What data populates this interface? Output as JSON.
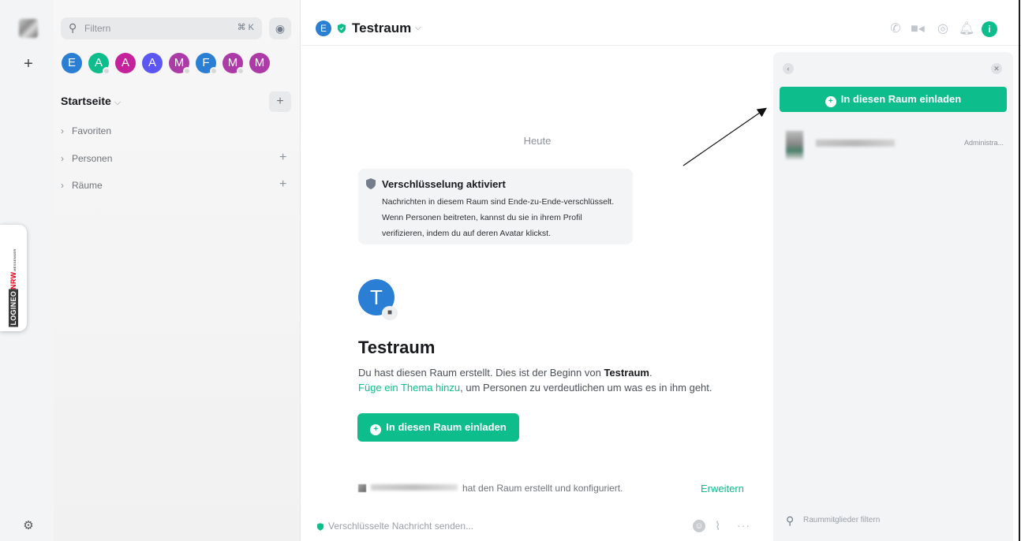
{
  "search": {
    "placeholder": "Filtern",
    "shortcut": "⌘ K"
  },
  "recents": [
    {
      "letter": "E",
      "color": "#2a7fd4"
    },
    {
      "letter": "A",
      "color": "#0dbd8b"
    },
    {
      "letter": "A",
      "color": "#c4219d"
    },
    {
      "letter": "A",
      "color": "#5c56f5"
    },
    {
      "letter": "M",
      "color": "#ac3ba8"
    },
    {
      "letter": "F",
      "color": "#2a7fd4"
    },
    {
      "letter": "M",
      "color": "#ac3ba8"
    },
    {
      "letter": "M",
      "color": "#ac3ba8"
    }
  ],
  "home": {
    "title": "Startseite"
  },
  "sections": {
    "favorites": "Favoriten",
    "people": "Personen",
    "rooms": "Räume"
  },
  "branding": {
    "log": "LOGINEO",
    "nrw": "NRW",
    "sub": "MESSENGER"
  },
  "room": {
    "avatar_letter": "E",
    "title": "Testraum"
  },
  "timeline": {
    "date_separator": "Heute",
    "encryption_title": "Verschlüsselung aktiviert",
    "encryption_body": "Nachrichten in diesem Raum sind Ende-zu-Ende-verschlüsselt. Wenn Personen beitreten, kannst du sie in ihrem Profil verifizieren, indem du auf deren Avatar klickst.",
    "room_avatar_letter": "T",
    "room_name": "Testraum",
    "intro_prefix": "Du hast diesen Raum erstellt. Dies ist der Beginn von ",
    "intro_room": "Testraum",
    "intro_suffix": ".",
    "topic_link": "Füge ein Thema hinzu",
    "topic_suffix": ", um Personen zu verdeutlichen um was es in ihm geht.",
    "invite_label": "In diesen Raum einladen",
    "created_event": "hat den Raum erstellt und konfiguriert.",
    "expand_label": "Erweitern"
  },
  "composer": {
    "placeholder": "Verschlüsselte Nachricht senden..."
  },
  "right_panel": {
    "invite_label": "In diesen Raum einladen",
    "member_role": "Administra...",
    "filter_placeholder": "Raummitglieder filtern"
  },
  "colors": {
    "accent": "#0dbd8b",
    "room_avatar": "#2a7fd4"
  }
}
